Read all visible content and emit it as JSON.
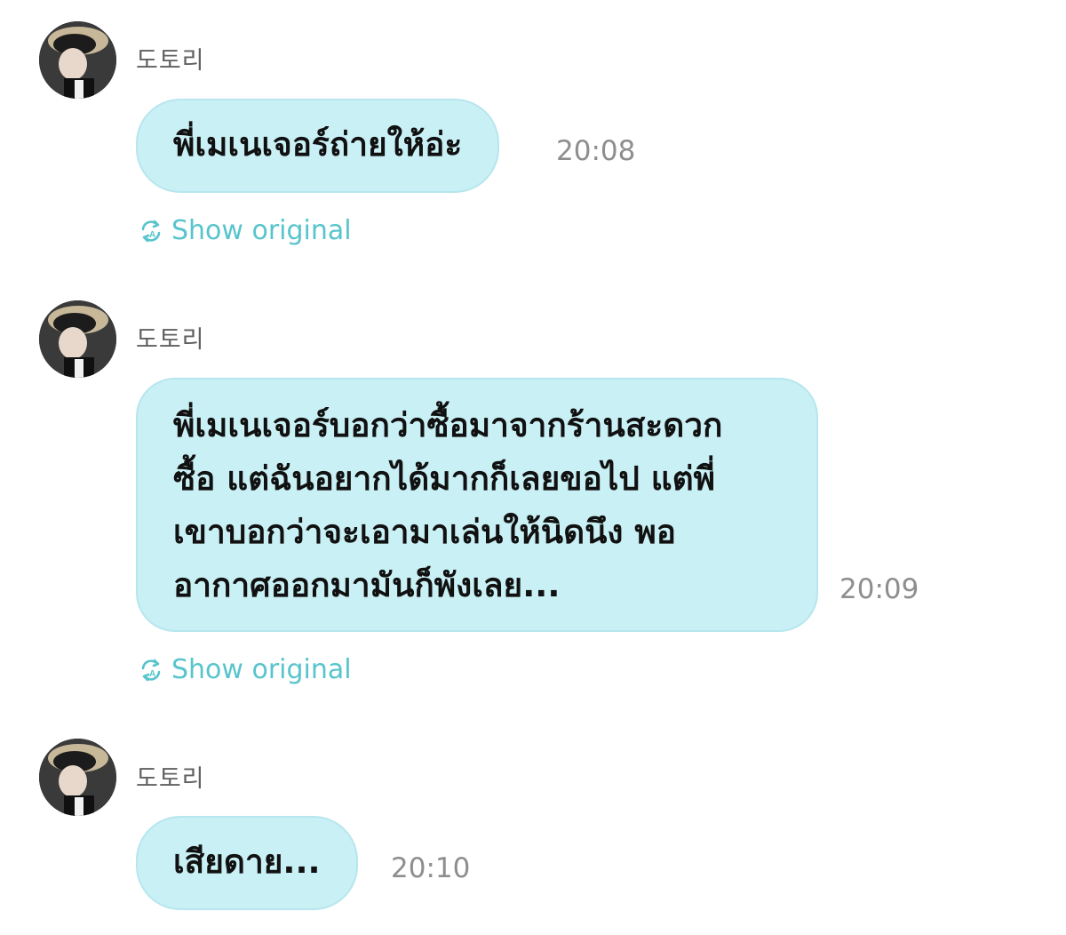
{
  "messages": [
    {
      "sender": "도토리",
      "text": "พี่เมเนเจอร์ถ่ายให้อ่ะ",
      "time": "20:08",
      "show_original": "Show original"
    },
    {
      "sender": "도토리",
      "text": "พี่เมเนเจอร์บอกว่าซื้อมาจากร้านสะดวก\nซื้อ แต่ฉันอยากได้มากก็เลยขอไป แต่พี่\nเขาบอกว่าจะเอามาเล่นให้นิดนึง พอ\nอากาศออกมามันก็พังเลย...",
      "time": "20:09",
      "show_original": "Show original"
    },
    {
      "sender": "도토리",
      "text": "เสียดาย...",
      "time": "20:10"
    }
  ],
  "icons": {
    "translate": "translate-icon",
    "avatar": "avatar"
  },
  "colors": {
    "bubble": "#c9f0f5",
    "link": "#58c4cc",
    "time": "#8e8e8e",
    "sender": "#606060"
  }
}
